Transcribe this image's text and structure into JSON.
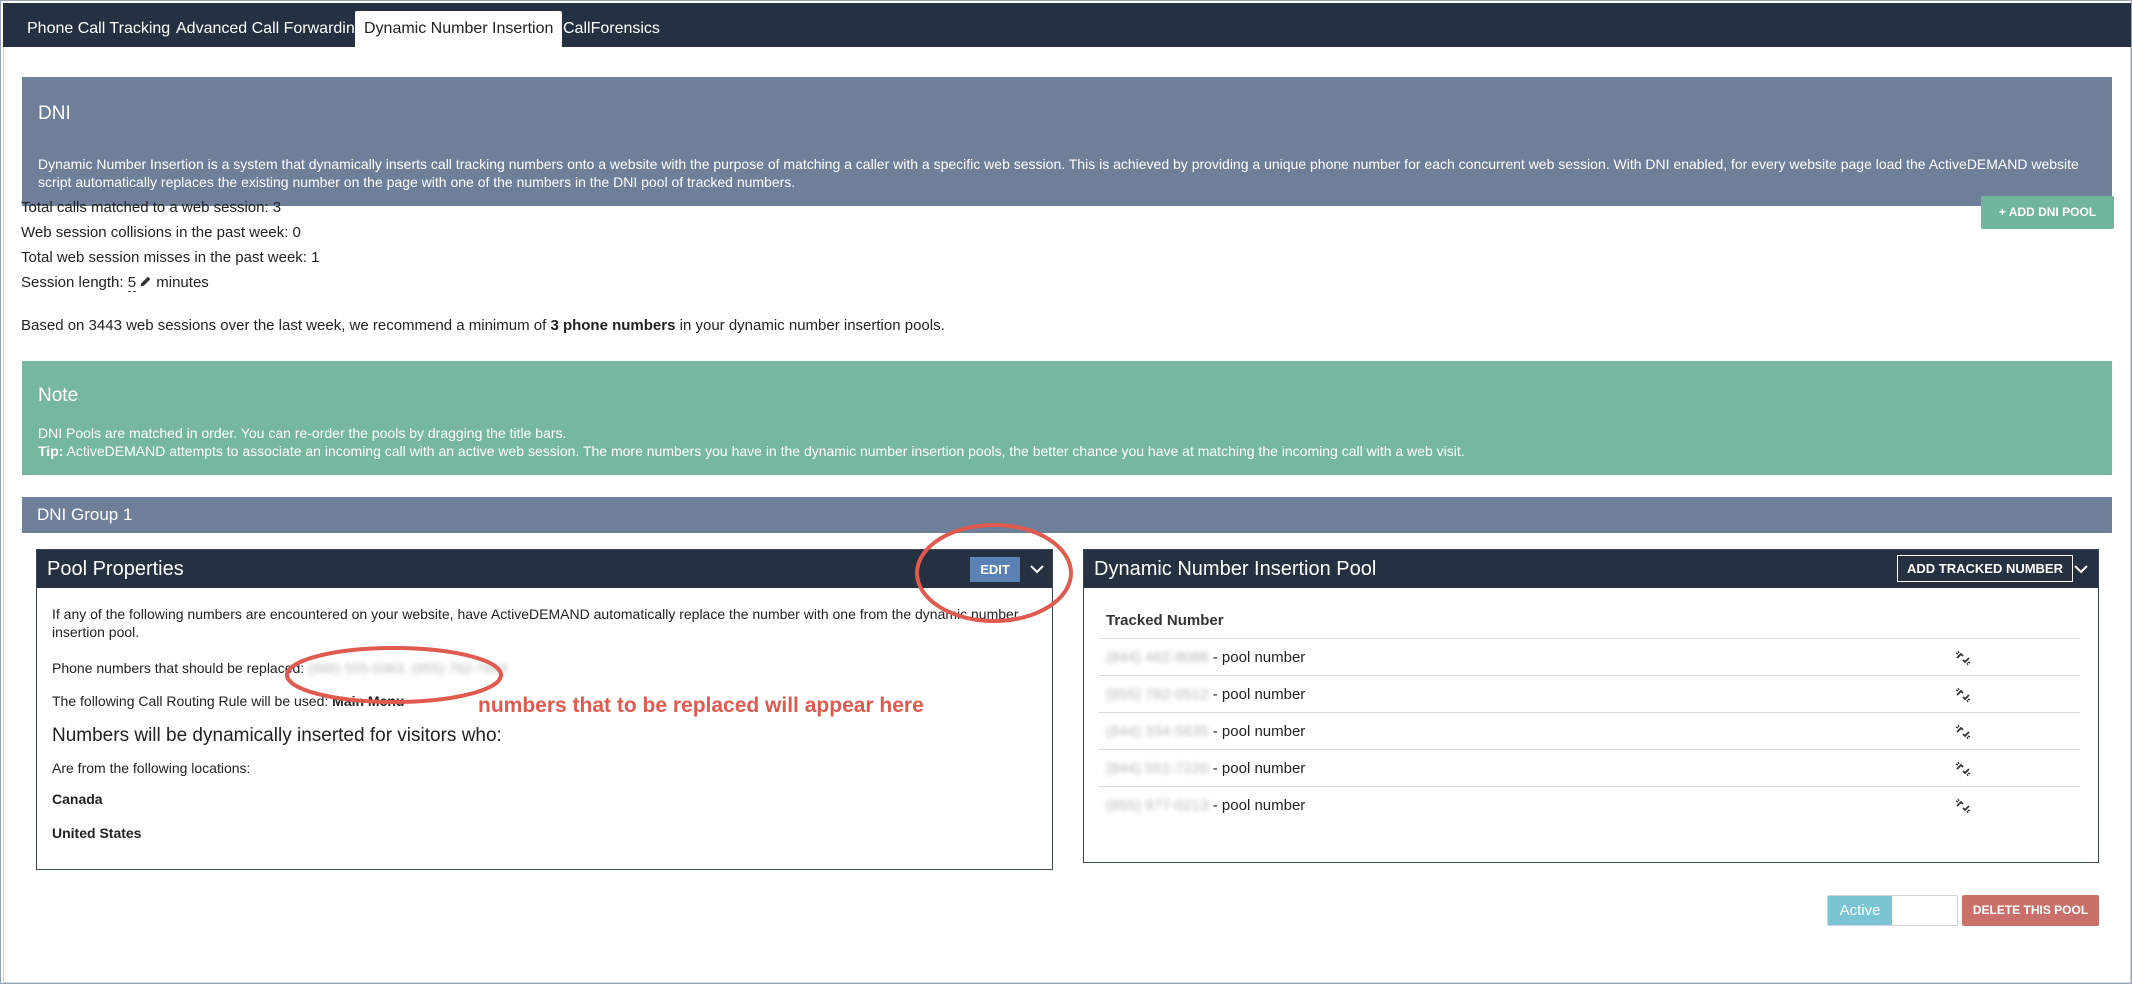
{
  "tabs": [
    {
      "label": "Phone Call Tracking",
      "active": false
    },
    {
      "label": "Advanced Call Forwarding",
      "active": false
    },
    {
      "label": "Dynamic Number Insertion",
      "active": true
    },
    {
      "label": "CallForensics",
      "active": false
    }
  ],
  "dni": {
    "title": "DNI",
    "description": "Dynamic Number Insertion is a system that dynamically inserts call tracking numbers onto a website with the purpose of matching a caller with a specific web session. This is achieved by providing a unique phone number for each concurrent web session. With DNI enabled, for every website page load the ActiveDEMAND website script automatically replaces the existing number on the page with one of the numbers in the DNI pool of tracked numbers."
  },
  "stats": {
    "total_calls": "Total calls matched to a web session: 3",
    "collisions": "Web session collisions in the past week: 0",
    "misses": "Total web session misses in the past week: 1",
    "session_label": "Session length:",
    "session_value": "5",
    "session_unit": "minutes"
  },
  "add_pool_button": "+ ADD DNI POOL",
  "recommend": {
    "before": "Based on 3443 web sessions over the last week, we recommend a minimum of",
    "bold": "3 phone numbers",
    "after": "in your dynamic number insertion pools."
  },
  "note": {
    "title": "Note",
    "line1": "DNI Pools are matched in order. You can re-order the pools by dragging the title bars.",
    "tip_label": "Tip:",
    "tip_text": "ActiveDEMAND attempts to associate an incoming call with an active web session. The more numbers you have in the dynamic number insertion pools, the better chance you have at matching the incoming call with a web visit."
  },
  "group": {
    "title": "DNI Group 1"
  },
  "pool_properties": {
    "title": "Pool Properties",
    "edit_label": "EDIT",
    "intro": "If any of the following numbers are encountered on your website, have ActiveDEMAND automatically replace the number with one from the dynamic number insertion pool.",
    "replace_label": "Phone numbers that should be replaced:",
    "replace_value": "(888) 555-0383, (855) 782-7643",
    "routing_label": "The following Call Routing Rule will be used:",
    "routing_value": "Main Menu",
    "visitors_heading": "Numbers will be dynamically inserted for visitors who:",
    "locations_label": "Are from the following locations:",
    "locations": [
      "Canada",
      "United States"
    ]
  },
  "annotation": {
    "text": "numbers that to be replaced will appear here",
    "color": "#e05a4f"
  },
  "dni_pool": {
    "title": "Dynamic Number Insertion Pool",
    "add_button": "ADD TRACKED NUMBER",
    "column_header": "Tracked Number",
    "rows": [
      {
        "number": "(844) 462-8088",
        "suffix": "- pool number"
      },
      {
        "number": "(855) 782-0512",
        "suffix": "- pool number"
      },
      {
        "number": "(844) 334-5635",
        "suffix": "- pool number"
      },
      {
        "number": "(844) 551-7220",
        "suffix": "- pool number"
      },
      {
        "number": "(855) 977-0213",
        "suffix": "- pool number"
      }
    ]
  },
  "active_toggle": {
    "label": "Active",
    "state": true
  },
  "delete_button": "DELETE THIS POOL",
  "colors": {
    "nav": "#253041",
    "slate": "#6e7f9a",
    "green": "#76b89e",
    "edit_blue": "#5a80b4",
    "toggle_on": "#7bc4d4",
    "delete_red": "#c9706b",
    "annotation_red": "#e05a4f"
  },
  "icons": {
    "chevron": "chevron-down-icon",
    "pencil": "pencil-icon",
    "unlink": "unlink-icon"
  }
}
